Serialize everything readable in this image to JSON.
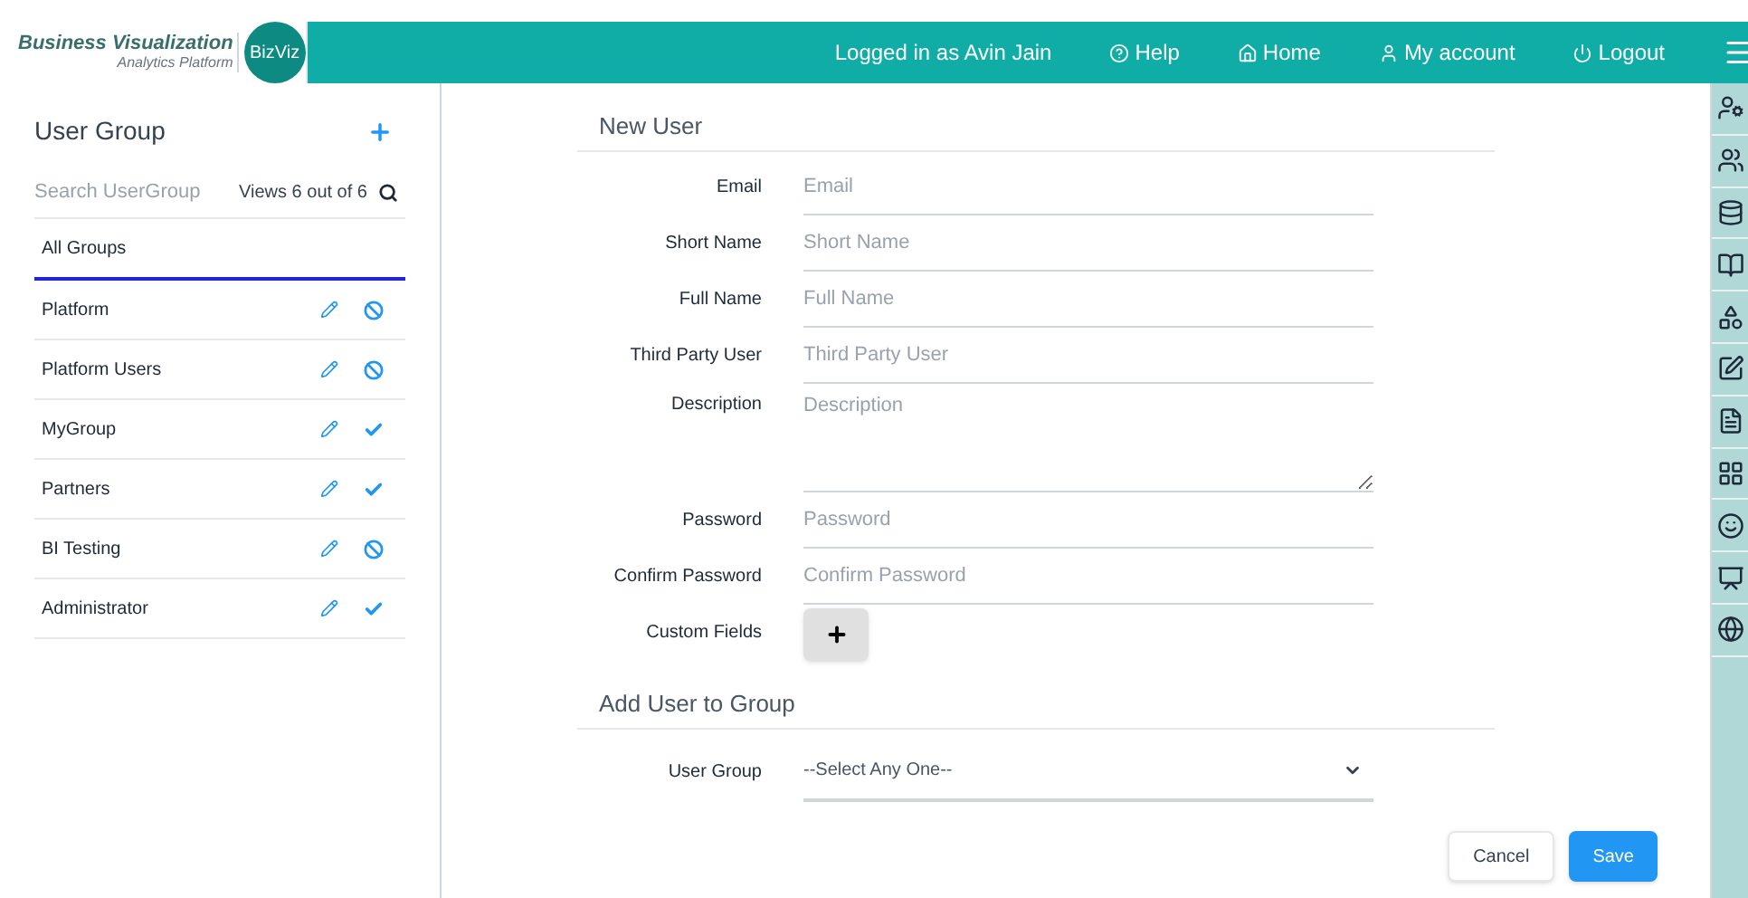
{
  "header": {
    "logo_title": "Business Visualization",
    "logo_subtitle": "Analytics Platform",
    "logo_badge": "BizViz",
    "user_text": "Logged in as Avin Jain",
    "nav": [
      {
        "label": "Help",
        "kind": "help"
      },
      {
        "label": "Home",
        "kind": "home"
      },
      {
        "label": "My account",
        "kind": "account"
      },
      {
        "label": "Logout",
        "kind": "logout"
      }
    ]
  },
  "sidebar": {
    "title": "User Group",
    "search": {
      "placeholder": "Search UserGroup"
    },
    "count": "Views 6 out of 6",
    "filter": {
      "label": "All Groups",
      "selected": true
    },
    "groups": [
      {
        "name": "Platform",
        "active": false
      },
      {
        "name": "Platform Users",
        "active": false
      },
      {
        "name": "MyGroup",
        "active": true
      },
      {
        "name": "Partners",
        "active": true
      },
      {
        "name": "BI Testing",
        "active": false
      },
      {
        "name": "Administrator",
        "active": true
      }
    ]
  },
  "form": {
    "title": "New User",
    "fields": [
      {
        "label": "Email",
        "kind": "input",
        "placeholder": "Email"
      },
      {
        "label": "Short Name",
        "kind": "input",
        "placeholder": "Short Name"
      },
      {
        "label": "Full Name",
        "kind": "input",
        "placeholder": "Full Name"
      },
      {
        "label": "Third Party User",
        "kind": "input",
        "placeholder": "Third Party User"
      },
      {
        "label": "Description",
        "kind": "textarea",
        "placeholder": "Description"
      },
      {
        "label": "Password",
        "kind": "input",
        "placeholder": "Password"
      },
      {
        "label": "Confirm Password",
        "kind": "input",
        "placeholder": "Confirm Password"
      },
      {
        "label": "Custom Fields",
        "kind": "add"
      }
    ],
    "group_title": "Add User to Group",
    "group_field": {
      "label": "User Group",
      "value": "--Select Any One--"
    },
    "buttons": [
      {
        "label": "Cancel",
        "kind": "secondary"
      },
      {
        "label": "Save",
        "kind": "primary"
      }
    ]
  }
}
